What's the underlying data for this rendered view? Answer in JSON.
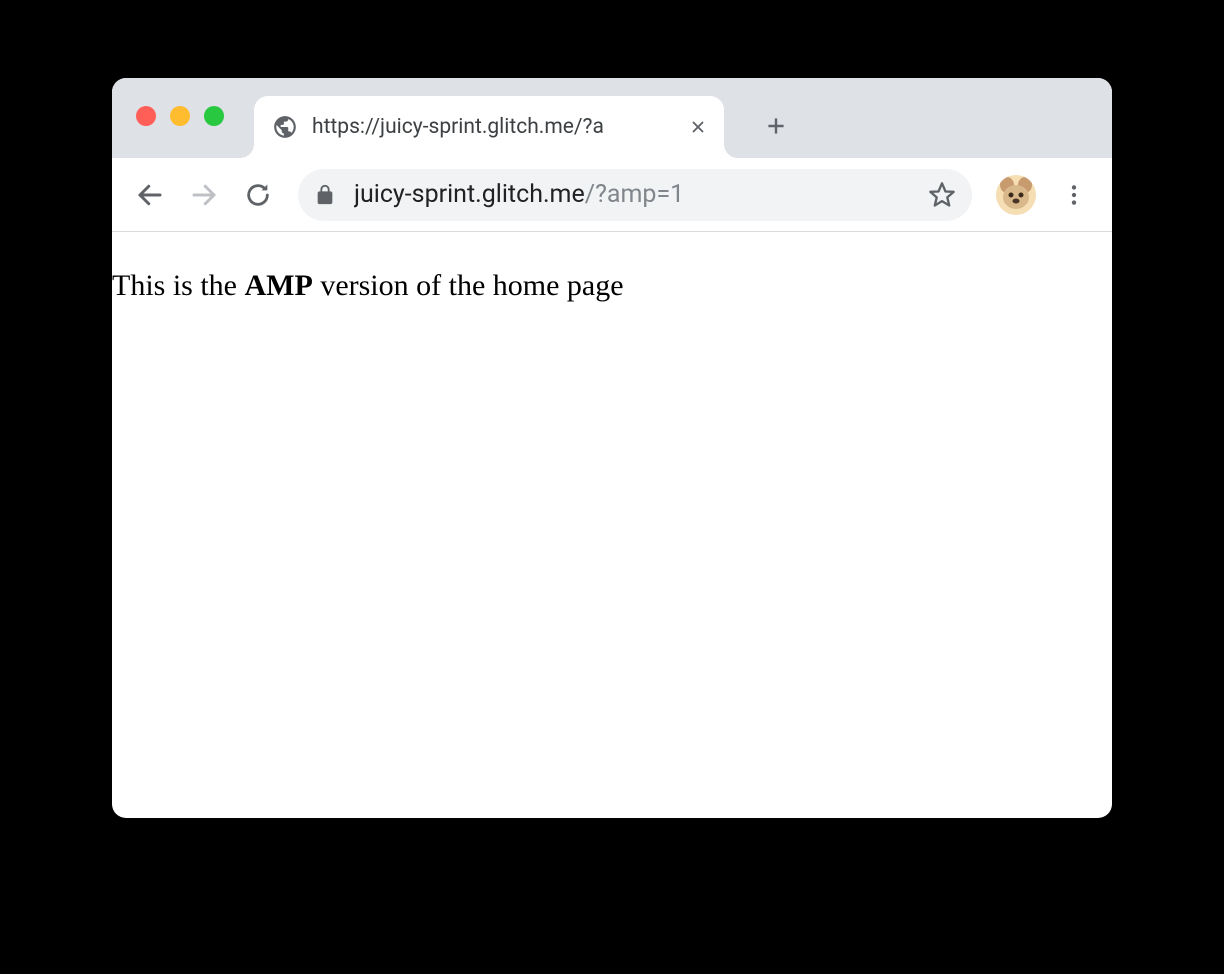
{
  "tab": {
    "title": "https://juicy-sprint.glitch.me/?a"
  },
  "omnibox": {
    "host": "juicy-sprint.glitch.me",
    "path": "/?amp=1"
  },
  "page": {
    "text_before": "This is the ",
    "bold": "AMP",
    "text_after": " version of the home page"
  }
}
